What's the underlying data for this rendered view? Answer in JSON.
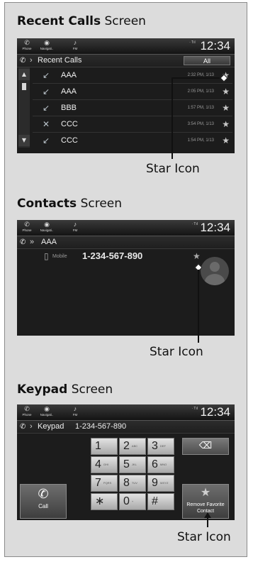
{
  "recent": {
    "title_bold": "Recent Calls",
    "title_rest": " Screen",
    "status": {
      "phone_label": "Phone",
      "navi_label": "Navigati..",
      "fm_label": "FM",
      "signal": "· Tıl   ",
      "clock": "12:34"
    },
    "header_text": "Recent Calls",
    "all_button": "All",
    "rows": [
      {
        "name": "AAA",
        "time": "2:32 PM, 1/13"
      },
      {
        "name": "AAA",
        "time": "2:05 PM, 1/13"
      },
      {
        "name": "BBB",
        "time": "1:57 PM, 1/13"
      },
      {
        "name": "CCC",
        "time": "3:54 PM, 1/13"
      },
      {
        "name": "CCC",
        "time": "1:54 PM, 1/13"
      }
    ],
    "callout": "Star Icon"
  },
  "contacts": {
    "title_bold": "Contacts",
    "title_rest": " Screen",
    "status": {
      "phone_label": "Phone",
      "navi_label": "Navigati..",
      "fm_label": "FM",
      "clock": "12:34"
    },
    "header_text": "AAA",
    "number_type": "Mobile",
    "number": "1-234-567-890",
    "callout": "Star Icon"
  },
  "keypad": {
    "title_bold": "Keypad",
    "title_rest": " Screen",
    "status": {
      "phone_label": "Phone",
      "navi_label": "Navigati..",
      "fm_label": "FM",
      "clock": "12:34"
    },
    "header_label": "Keypad",
    "header_number": "1-234-567-890",
    "keys": [
      {
        "d": "1",
        "s": ""
      },
      {
        "d": "2",
        "s": "ABC"
      },
      {
        "d": "3",
        "s": "DEF"
      },
      {
        "d": "4",
        "s": "GHI"
      },
      {
        "d": "5",
        "s": "JKL"
      },
      {
        "d": "6",
        "s": "MNO"
      },
      {
        "d": "7",
        "s": "PQRS"
      },
      {
        "d": "8",
        "s": "TUV"
      },
      {
        "d": "9",
        "s": "WXYZ"
      },
      {
        "d": "∗",
        "s": ""
      },
      {
        "d": "0",
        "s": "+"
      },
      {
        "d": "#",
        "s": ""
      }
    ],
    "call_label": "Call",
    "fav_label_1": "Remove Favorite",
    "fav_label_2": "Contact",
    "callout": "Star Icon"
  },
  "icons": {
    "phone": "phone-icon",
    "navi": "navigation-icon",
    "fm": "radio-icon",
    "star": "star-icon",
    "backspace": "backspace-icon",
    "call": "call-handset-icon",
    "avatar": "contact-avatar-icon"
  }
}
